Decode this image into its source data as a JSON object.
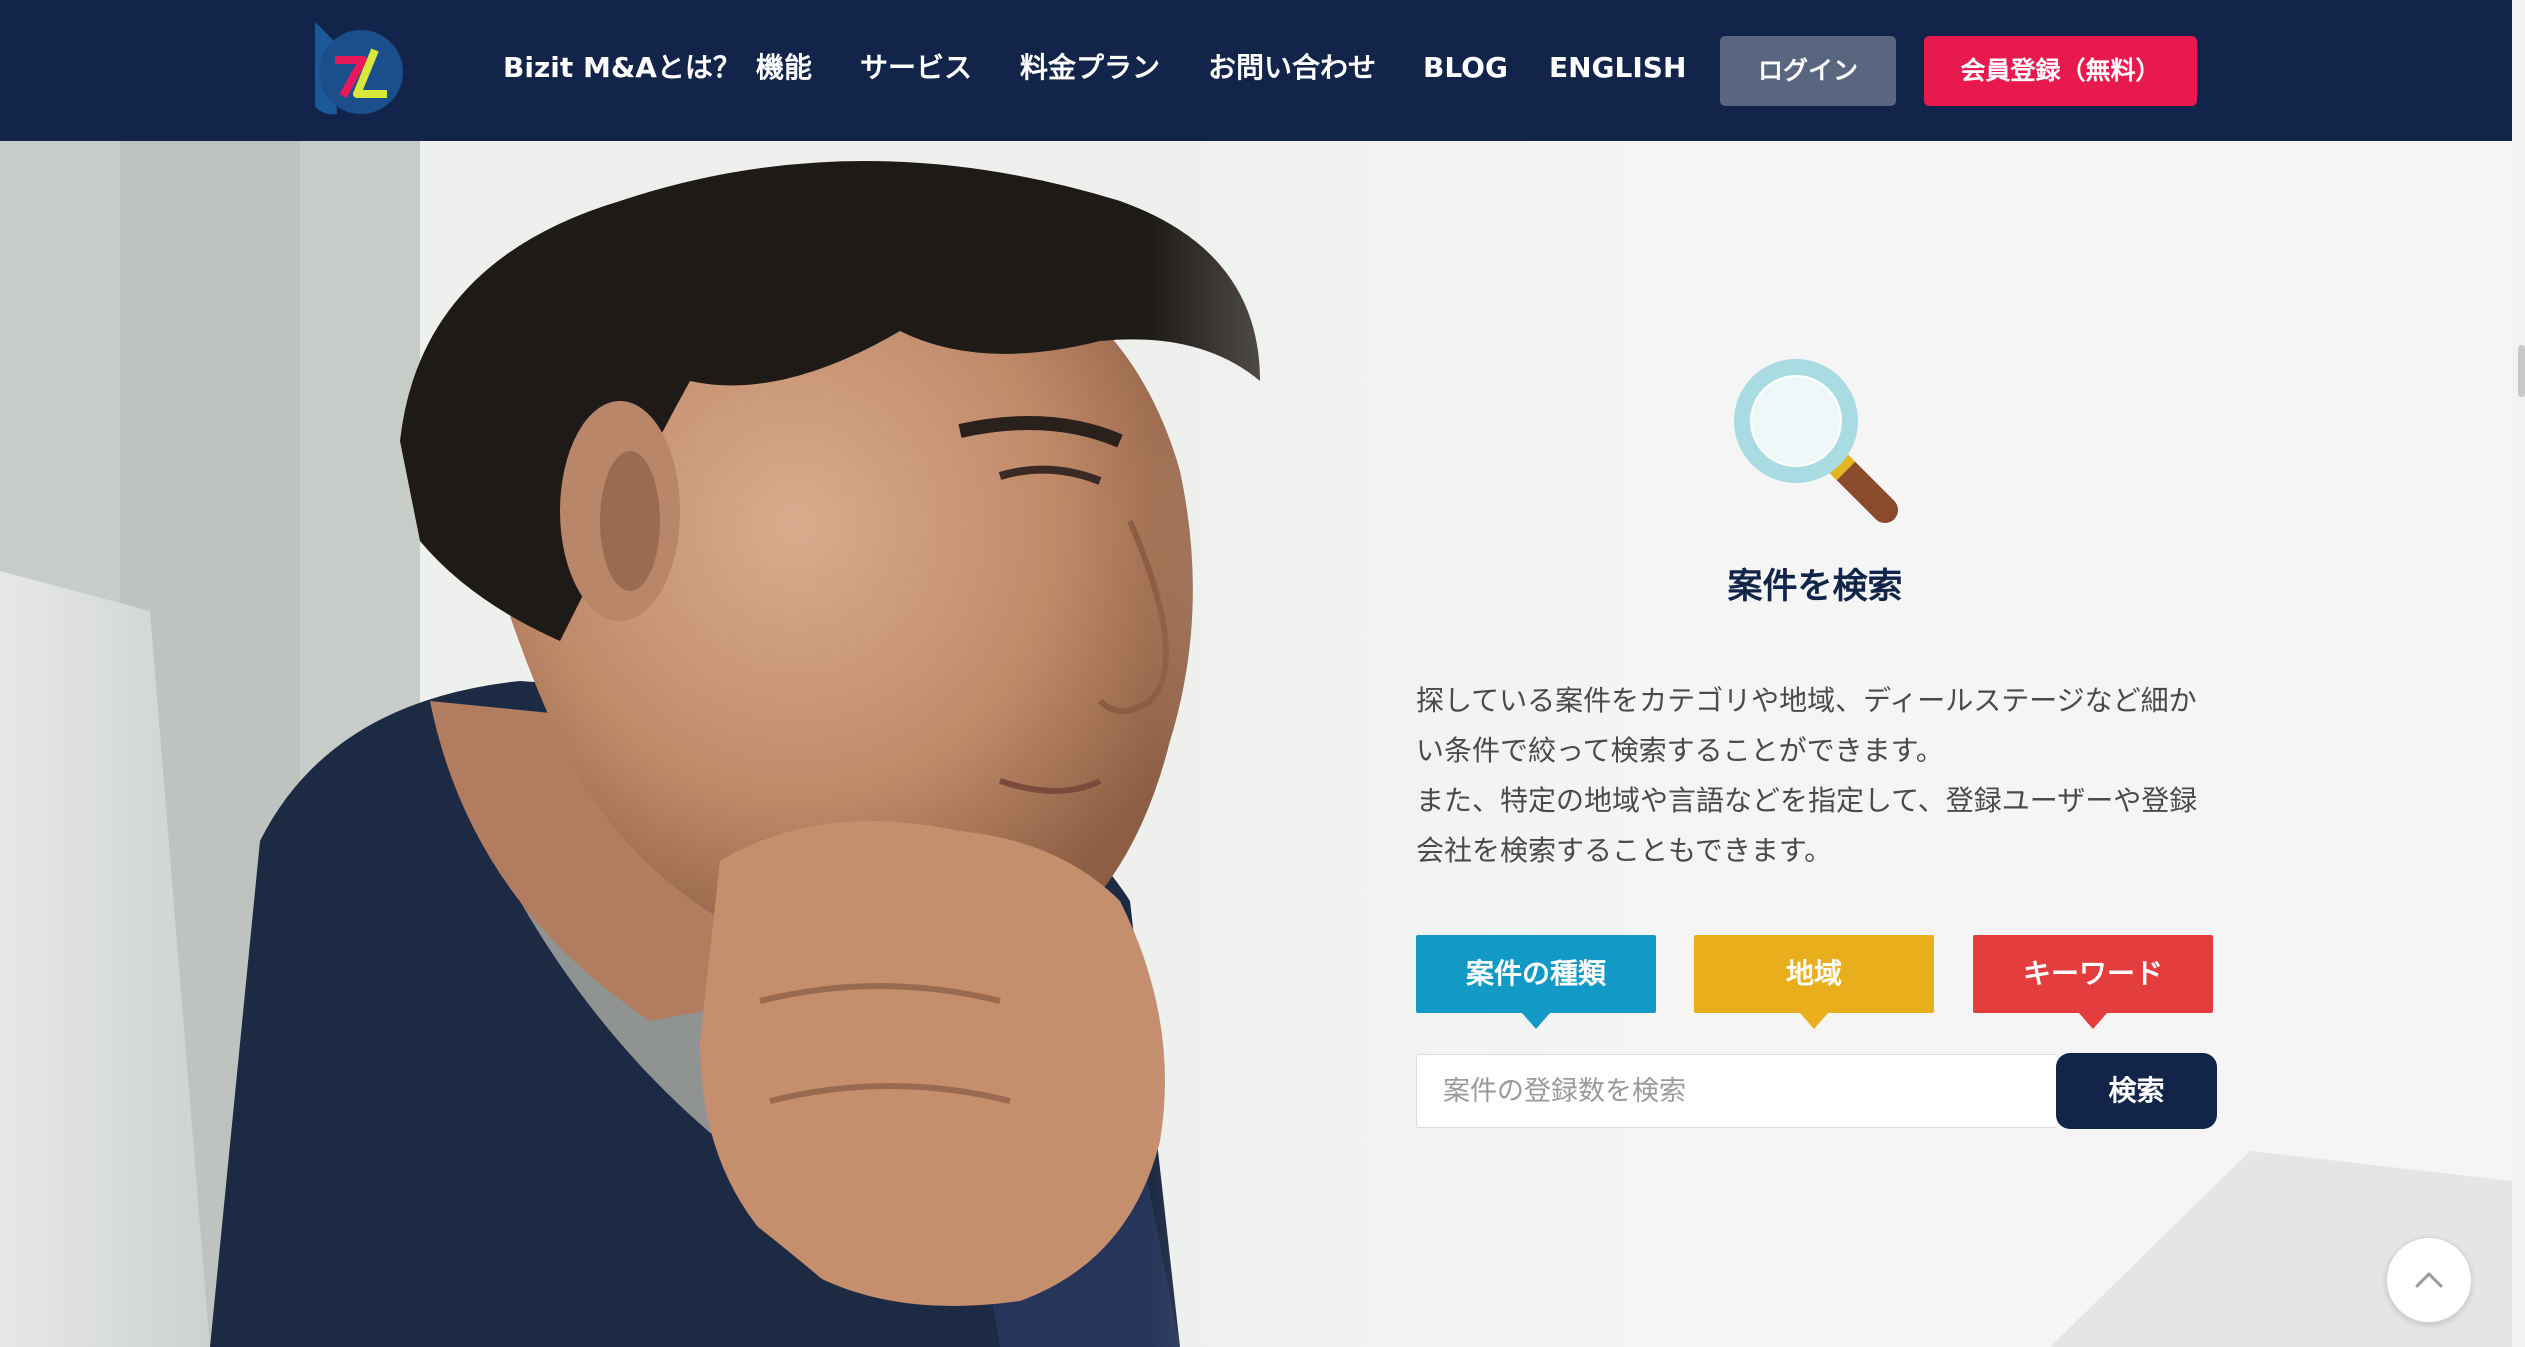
{
  "header": {
    "logo_icon": "bizit-logo-icon",
    "nav": [
      {
        "label": "Bizit M&Aとは？"
      },
      {
        "label": "機能"
      },
      {
        "label": "サービス"
      },
      {
        "label": "料金プラン"
      },
      {
        "label": "お問い合わせ"
      },
      {
        "label": "BLOG"
      },
      {
        "label": "ENGLISH"
      }
    ],
    "login_label": "ログイン",
    "register_label": "会員登録（無料）"
  },
  "search_panel": {
    "icon": "magnifier-icon",
    "title": "案件を検索",
    "description": [
      "探している案件をカテゴリや地域、ディールステージなど細かい条件で絞って検索することができます。",
      "また、特定の地域や言語などを指定して、登録ユーザーや登録会社を検索することもできます。"
    ],
    "tabs": [
      {
        "label": "案件の種類",
        "color": "#1399c6"
      },
      {
        "label": "地域",
        "color": "#e8ae1c"
      },
      {
        "label": "キーワード",
        "color": "#e33d3d"
      }
    ],
    "input_placeholder": "案件の登録数を検索",
    "input_value": "",
    "search_button_label": "検索"
  },
  "colors": {
    "header_bg": "#12244a",
    "login_bg": "#5a6680",
    "register_bg": "#e8194f",
    "search_button_bg": "#12244a"
  },
  "back_to_top_icon": "chevron-up-icon"
}
